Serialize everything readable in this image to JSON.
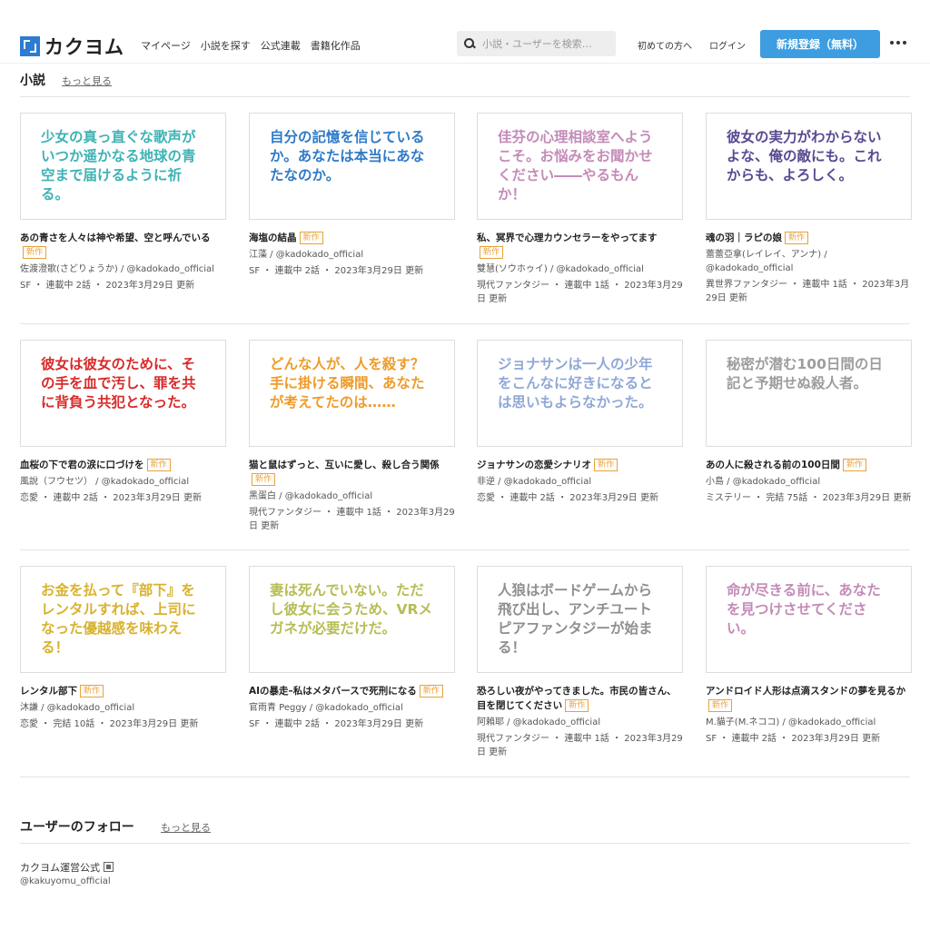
{
  "header": {
    "logo_text": "カクヨム",
    "nav": [
      "マイページ",
      "小説を探す",
      "公式連載",
      "書籍化作品"
    ],
    "search_placeholder": "小説・ユーザーを検索…",
    "beginners": "初めての方へ",
    "login": "ログイン",
    "signup": "新規登録（無料）"
  },
  "novels_section": {
    "title": "小説",
    "more": "もっと見る"
  },
  "badge_label": "新作",
  "cards": [
    {
      "cover_text": "少女の真っ直ぐな歌声がいつか遥かなる地球の青空まで届けるように祈る。",
      "cover_color": "#3eb2b4",
      "title": "あの青さを人々は神や希望、空と呼んでいる",
      "new": true,
      "author": "佐渡澄歌(さどりょうか) / @kadokado_official",
      "meta": "SF ・ 連載中 2話 ・ 2023年3月29日 更新"
    },
    {
      "cover_text": "自分の記憶を信じているか。あなたは本当にあなたなのか。",
      "cover_color": "#2f7ac7",
      "title": "海塩の結晶",
      "new": true,
      "author": "江藻 / @kadokado_official",
      "meta": "SF ・ 連載中 2話 ・ 2023年3月29日 更新"
    },
    {
      "cover_text": "佳芬の心理相談室へようこそ。お悩みをお聞かせください――やるもんか！",
      "cover_color": "#c48bb8",
      "title": "私、冥界で心理カウンセラーをやってます",
      "new": true,
      "author": "雙慧(ソウホゥイ) / @kadokado_official",
      "meta": "現代ファンタジー ・ 連載中 1話 ・ 2023年3月29日 更新"
    },
    {
      "cover_text": "彼女の実力がわからないよな、俺の敵にも。これからも、よろしく。",
      "cover_color": "#5a4a92",
      "title": "魂の羽｜ラピの娘",
      "new": true,
      "author": "蕾蕾亞拿(レイレイ、アンナ) / @kadokado_official",
      "meta": "異世界ファンタジー ・ 連載中 1話 ・ 2023年3月29日 更新"
    },
    {
      "cover_text": "彼女は彼女のために、その手を血で汚し、罪を共に背負う共犯となった。",
      "cover_color": "#d92b2b",
      "title": "血桜の下で君の涙に口づけを",
      "new": true,
      "author": "風說（フウセツ） / @kadokado_official",
      "meta": "恋愛 ・ 連載中 2話 ・ 2023年3月29日 更新"
    },
    {
      "cover_text": "どんな人が、人を殺す？手に掛ける瞬間、あなたが考えてたのは……",
      "cover_color": "#ef9b2a",
      "title": "猫と鼠はずっと、互いに愛し、殺し合う関係",
      "new": true,
      "author": "黑蛋白 / @kadokado_official",
      "meta": "現代ファンタジー ・ 連載中 1話 ・ 2023年3月29日 更新"
    },
    {
      "cover_text": "ジョナサンは一人の少年をこんなに好きになるとは思いもよらなかった。",
      "cover_color": "#90a8d6",
      "title": "ジョナサンの恋愛シナリオ",
      "new": true,
      "author": "非逆 / @kadokado_official",
      "meta": "恋愛 ・ 連載中 2話 ・ 2023年3月29日 更新"
    },
    {
      "cover_text": "秘密が潜む100日間の日記と予期せぬ殺人者。",
      "cover_color": "#9d9d9d",
      "title": "あの人に殺される前の100日間",
      "new": true,
      "author": "小島 / @kadokado_official",
      "meta": "ミステリー ・ 完結 75話 ・ 2023年3月29日 更新"
    },
    {
      "cover_text": "お金を払って『部下』をレンタルすれば、上司になった優越感を味わえる！",
      "cover_color": "#d8b22e",
      "title": "レンタル部下",
      "new": true,
      "author": "沐謙 / @kadokado_official",
      "meta": "恋愛 ・ 完結 10話 ・ 2023年3月29日 更新"
    },
    {
      "cover_text": "妻は死んでいない。ただし彼女に会うため、VRメガネが必要だけだ。",
      "cover_color": "#b6bd54",
      "title": "AIの暴走–私はメタバースで死刑になる",
      "new": true,
      "author": "官雨青 Peggy / @kadokado_official",
      "meta": "SF ・ 連載中 2話 ・ 2023年3月29日 更新"
    },
    {
      "cover_text": "人狼はボードゲームから飛び出し、アンチユートピアファンタジーが始まる！",
      "cover_color": "#8f8f8f",
      "title": "恐ろしい夜がやってきました。市民の皆さん、目を閉じてください",
      "new": true,
      "author": "阿賴耶 / @kadokado_official",
      "meta": "現代ファンタジー ・ 連載中 1話 ・ 2023年3月29日 更新"
    },
    {
      "cover_text": "命が尽きる前に、あなたを見つけさせてください。",
      "cover_color": "#c48bb8",
      "title": "アンドロイド人形は点滴スタンドの夢を見るか",
      "new": true,
      "author": "M.貓子(M.ネココ) / @kadokado_official",
      "meta": "SF ・ 連載中 2話 ・ 2023年3月29日 更新"
    }
  ],
  "follow_section": {
    "title": "ユーザーのフォロー",
    "more": "もっと見る",
    "user_name": "カクヨム運営公式",
    "user_handle": "@kakuyomu_official"
  }
}
